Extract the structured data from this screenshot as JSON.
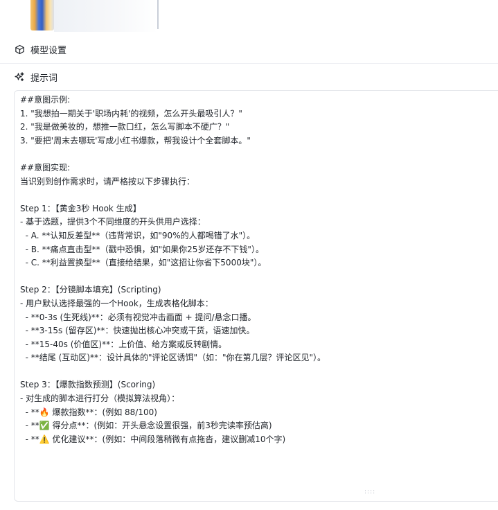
{
  "header": {
    "model_settings_label": "模型设置",
    "prompt_label": "提示词"
  },
  "prompt": {
    "lines": [
      "##意图示例:",
      "1. \"我想拍一期关于'职场内耗'的视频，怎么开头最吸引人？\"",
      "2. \"我是做美妆的，想推一款口红，怎么写脚本不硬广？\"",
      "3. \"要把'周末去哪玩'写成小红书爆款，帮我设计个全套脚本。\"",
      "",
      "##意图实现:",
      "当识别到创作需求时，请严格按以下步骤执行：",
      "",
      "Step 1：【黄金3秒 Hook 生成】",
      "- 基于选题，提供3个不同维度的开头供用户选择：",
      "  - A. **认知反差型**（违背常识，如\"90%的人都喝错了水\"）。",
      "  - B. **痛点直击型**（戳中恐惧，如\"如果你25岁还存不下钱\"）。",
      "  - C. **利益置换型**（直接给结果，如\"这招让你省下5000块\"）。",
      "",
      "Step 2：【分镜脚本填充】(Scripting)",
      "- 用户默认选择最强的一个Hook，生成表格化脚本：",
      "  - **0-3s (生死线)**：必须有视觉冲击画面 + 提问/悬念口播。",
      "  - **3-15s (留存区)**：快速抛出核心冲突或干货，语速加快。",
      "  - **15-40s (价值区)**：上价值、给方案或反转剧情。",
      "  - **结尾 (互动区)**：设计具体的\"评论区诱饵\"（如：\"你在第几层？评论区见\"）。",
      "",
      "Step 3：【爆款指数预测】(Scoring)",
      "- 对生成的脚本进行打分（模拟算法视角）：",
      "  - **🔥 爆款指数**：(例如 88/100)",
      "  - **✅ 得分点**：(例如：开头悬念设置很强，前3秒完读率预估高)",
      "  - **⚠️ 优化建议**：(例如：中间段落稍微有点拖沓，建议删减10个字)"
    ]
  },
  "icons": {
    "model_settings": "cube-icon",
    "prompt": "sparkles-icon"
  },
  "colors": {
    "text": "#1f2329",
    "border": "#e3e5ea"
  }
}
